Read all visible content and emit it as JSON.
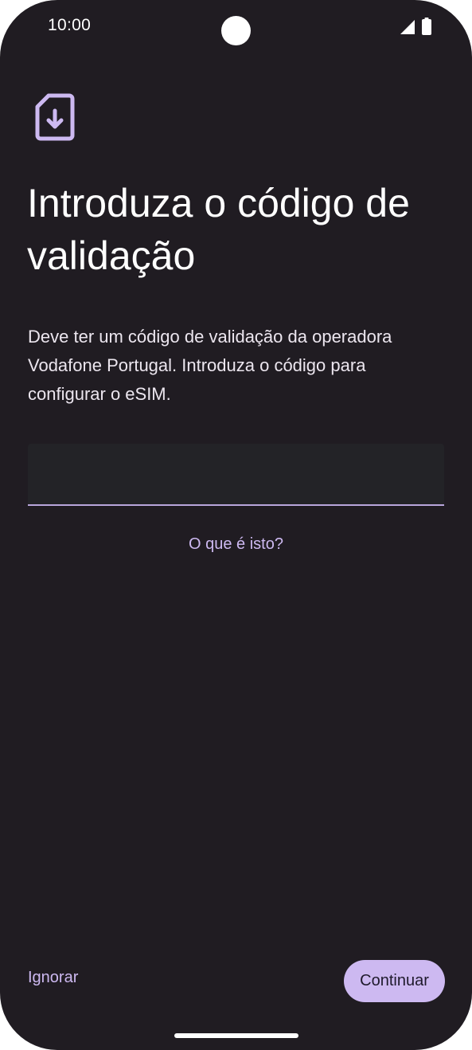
{
  "status_bar": {
    "time": "10:00",
    "icons": [
      "signal-icon",
      "battery-icon"
    ]
  },
  "header": {
    "icon": "esim-download-icon",
    "title": "Introduza o código de validação"
  },
  "body": {
    "description": "Deve ter um código de validação da operadora Vodafone Portugal. Introduza o código para configurar o eSIM.",
    "code_field": {
      "value": "",
      "placeholder": ""
    },
    "help_link": "O que é isto?"
  },
  "footer": {
    "skip_label": "Ignorar",
    "continue_label": "Continuar"
  },
  "colors": {
    "background": "#201c22",
    "accent": "#cdb9f1",
    "field_background": "#232327",
    "field_underline": "#b9a6dc",
    "text": "#ffffff"
  }
}
